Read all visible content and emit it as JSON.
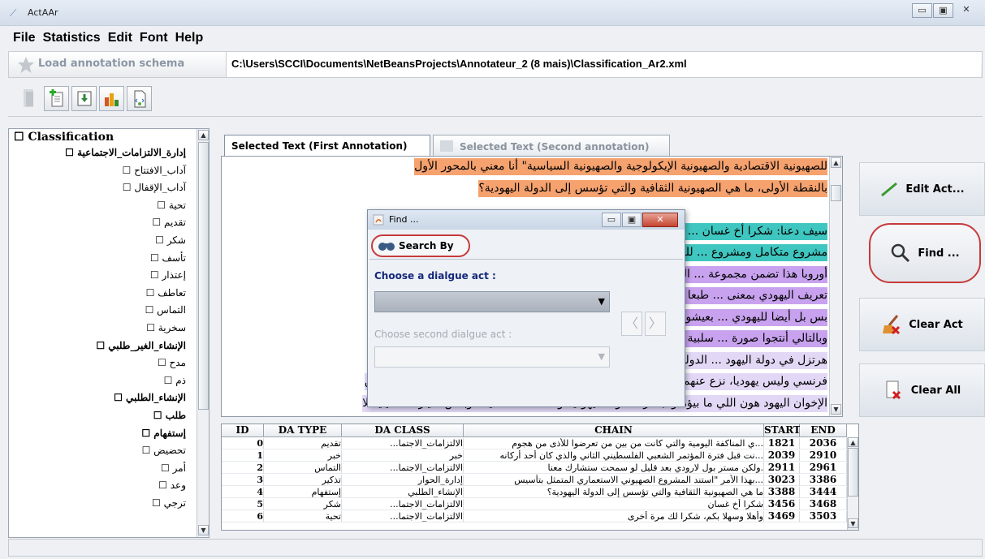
{
  "window": {
    "title": "ActAAr",
    "min": "▭",
    "max": "▣",
    "close": "✕"
  },
  "menu": [
    "File",
    "Statistics",
    "Edit",
    "Font",
    "Help"
  ],
  "load": {
    "label": "Load annotation schema",
    "path": "C:\\Users\\SCCI\\Documents\\NetBeansProjects\\Annotateur_2 (8 mais)\\Classification_Ar2.xml"
  },
  "toolbar_icons": [
    "exit-icon",
    "add-document-icon",
    "save-icon",
    "statistics-chart-icon",
    "export-xml-icon"
  ],
  "tree": {
    "root": "Classification",
    "items": [
      {
        "label": "إدارة_الالتزامات_الاجتماعية",
        "group": true
      },
      {
        "label": "آداب_الافتتاح"
      },
      {
        "label": "آداب_الإقفال"
      },
      {
        "label": "تحية"
      },
      {
        "label": "تقديم"
      },
      {
        "label": "شكر"
      },
      {
        "label": "تأسف"
      },
      {
        "label": "إعتذار"
      },
      {
        "label": "تعاطف"
      },
      {
        "label": "التماس"
      },
      {
        "label": "سخرية"
      },
      {
        "label": "الإنشاء_الغير_طلبي",
        "group": true
      },
      {
        "label": "مدح"
      },
      {
        "label": "ذم"
      },
      {
        "label": "الإنشاء_الطلبي",
        "group": true
      },
      {
        "label": "طلب",
        "group": true
      },
      {
        "label": "إستفهام",
        "group": true
      },
      {
        "label": "تحضيض"
      },
      {
        "label": "أمر"
      },
      {
        "label": "وعد"
      },
      {
        "label": "ترجي"
      }
    ]
  },
  "tabs": {
    "first": "Selected Text (First Annotation)",
    "second": "Selected Text (Second annotation)"
  },
  "text_lines": [
    {
      "text": "للصهيونية الاقتصادية والصهيونية الإيكولوجية والصهيونية السياسية\" أنا معني بالمحور الأول",
      "color": "#f5a26f"
    },
    {
      "text": "بالنقطة الأولى، ما هي الصهيونية الثقافية والتي تؤسس إلى الدولة اليهودية؟",
      "color": "#f5a26f"
    },
    {
      "text": "",
      "color": "#ffffff"
    },
    {
      "text": "سيف دعنا: شكرا أخ غسان ... مشروع الصهيوني",
      "color": "#3fc6c0"
    },
    {
      "text": "مشروع متكامل ومشروع ... للمشكلة اليهودية في",
      "color": "#3fc6c0"
    },
    {
      "text": "أوروبا هذا تضمن مجموعة ... القضية الأولى إعادة",
      "color": "#c8a2ee"
    },
    {
      "text": "تعريف اليهودي بمعنى ... طبعا مش للفلسطيني",
      "color": "#c8a2ee"
    },
    {
      "text": "بس بل أيضا لليهودي ... بعيشون بين ظهرانيها",
      "color": "#c8a2ee"
    },
    {
      "text": "وبالتالي أنتجوا صورة ... سلبية عن اليهودي،",
      "color": "#c8a2ee"
    },
    {
      "text": "هرتزل في دولة اليهود ... الدولة اليهودية هو",
      "color": "#e2d8f6"
    },
    {
      "text": "فرنسي وليس يهوديا، نزع عنهم صفة اليهودية. القضية الثانية إعادة تعريف اليهودية وفي مجموعة من",
      "color": "#e2d8f6"
    },
    {
      "text": "الإخوان اليهود هون اللي ما بيؤمنوا بفكرة الدولة اليهودية وهذه مسألة قديمة وبعض التيارات الدينية لا",
      "color": "#e2d8f6"
    }
  ],
  "side_buttons": [
    {
      "label": "Edit Act...",
      "icon": "pencil-icon"
    },
    {
      "label": "Find ...",
      "icon": "magnifier-icon"
    },
    {
      "label": "Clear Act",
      "icon": "broom-icon"
    },
    {
      "label": "Clear All",
      "icon": "eraser-icon"
    }
  ],
  "table": {
    "headers": [
      "ID",
      "DA TYPE",
      "DA CLASS",
      "CHAIN",
      "START",
      "END"
    ],
    "rows": [
      [
        "0",
        "تقديم",
        "الالتزامات_الاجتما...",
        "...ي المناكفة اليومية والتي كانت من بين من تعرضوا للأذى من هجوم",
        "1821",
        "2036"
      ],
      [
        "1",
        "خبر",
        "خبر",
        "...نت قبل فترة المؤتمر الشعبي الفلسطيني الثاني والذي كان أحد أركانه",
        "2039",
        "2910"
      ],
      [
        "2",
        "التماس",
        "الالتزامات_الاجتما...",
        ".ولكن مستر بول لارودي بعد قليل لو سمحت ستشارك معنا",
        "2911",
        "2961"
      ],
      [
        "3",
        "تذكير",
        "إدارة_الحوار",
        "...بهذا الأمر \"استند المشروع الصهيوني الاستعماري المتمثل بتأسيس",
        "3023",
        "3386"
      ],
      [
        "4",
        "إستفهام",
        "الإنشاء_الطلبي",
        "ما هي الصهيونية الثقافية والتي تؤسس إلى الدولة اليهودية؟",
        "3388",
        "3444"
      ],
      [
        "5",
        "شكر",
        "الالتزامات_الاجتما...",
        "شكرا أخ غسان",
        "3456",
        "3468"
      ],
      [
        "6",
        "تحية",
        "الالتزامات_الاجتما...",
        "وأهلا وسهلا بكم، شكرا لك مرة أخرى",
        "3469",
        "3503"
      ]
    ]
  },
  "dialog": {
    "title": "Find ...",
    "tab_label": "Search By",
    "label1": "Choose a dialgue act :",
    "label2": "Choose second dialgue act :",
    "prev": "〈",
    "next": "〉",
    "min": "▭",
    "max": "▣",
    "close": "✕"
  }
}
